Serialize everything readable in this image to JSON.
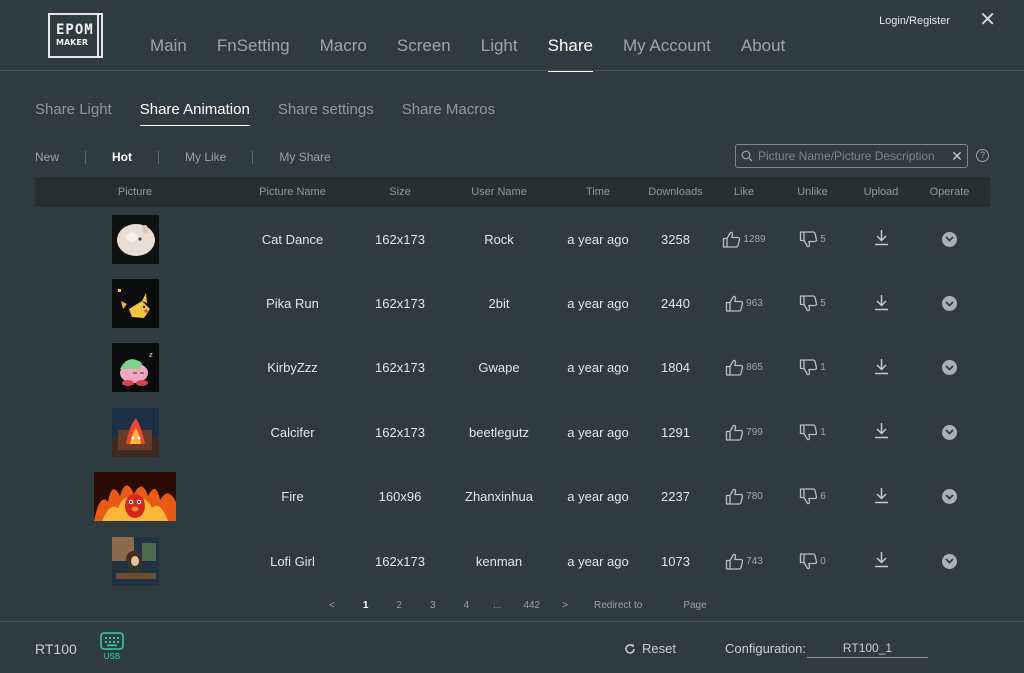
{
  "brand": {
    "line1": "EPOM",
    "line2": "MAKER"
  },
  "nav": [
    "Main",
    "FnSetting",
    "Macro",
    "Screen",
    "Light",
    "Share",
    "My Account",
    "About"
  ],
  "nav_active": "Share",
  "header": {
    "login": "Login/Register",
    "close_glyph": "✕"
  },
  "subtabs": [
    "Share Light",
    "Share Animation",
    "Share settings",
    "Share Macros"
  ],
  "subtab_active": "Share Animation",
  "filters": [
    "New",
    "Hot",
    "My Like",
    "My Share"
  ],
  "filter_active": "Hot",
  "search": {
    "placeholder": "Picture Name/Picture Description",
    "clear_glyph": "✕",
    "help_glyph": "?"
  },
  "table": {
    "headers": [
      "Picture",
      "Picture Name",
      "Size",
      "User Name",
      "Time",
      "Downloads",
      "Like",
      "Unlike",
      "Upload",
      "Operate"
    ],
    "rows": [
      {
        "name": "Cat Dance",
        "size": "162x173",
        "user": "Rock",
        "time": "a year ago",
        "downloads": "3258",
        "like": "1289",
        "unlike": "5",
        "thumb": "cat"
      },
      {
        "name": "Pika Run",
        "size": "162x173",
        "user": "2bit",
        "time": "a year ago",
        "downloads": "2440",
        "like": "963",
        "unlike": "5",
        "thumb": "pika"
      },
      {
        "name": "KirbyZzz",
        "size": "162x173",
        "user": "Gwape",
        "time": "a year ago",
        "downloads": "1804",
        "like": "865",
        "unlike": "1",
        "thumb": "kirby"
      },
      {
        "name": "Calcifer",
        "size": "162x173",
        "user": "beetlegutz",
        "time": "a year ago",
        "downloads": "1291",
        "like": "799",
        "unlike": "1",
        "thumb": "calcifer"
      },
      {
        "name": "Fire",
        "size": "160x96",
        "user": "Zhanxinhua",
        "time": "a year ago",
        "downloads": "2237",
        "like": "780",
        "unlike": "6",
        "thumb": "fire"
      },
      {
        "name": "Lofi Girl",
        "size": "162x173",
        "user": "kenman",
        "time": "a year ago",
        "downloads": "1073",
        "like": "743",
        "unlike": "0",
        "thumb": "lofi"
      }
    ]
  },
  "pagination": {
    "prev": "<",
    "pages": [
      "1",
      "2",
      "3",
      "4",
      "...",
      "442"
    ],
    "next": ">",
    "active": "1",
    "redirect": "Redirect to",
    "page_label": "Page"
  },
  "footer": {
    "device": "RT100",
    "usb": "USB",
    "reset": "Reset",
    "config_label": "Configuration:",
    "config_value": "RT100_1"
  },
  "colors": {
    "background": "#2f3c3f",
    "header_row": "#25302f",
    "accent_usb": "#36c9b1",
    "active_text": "#ffffff"
  }
}
